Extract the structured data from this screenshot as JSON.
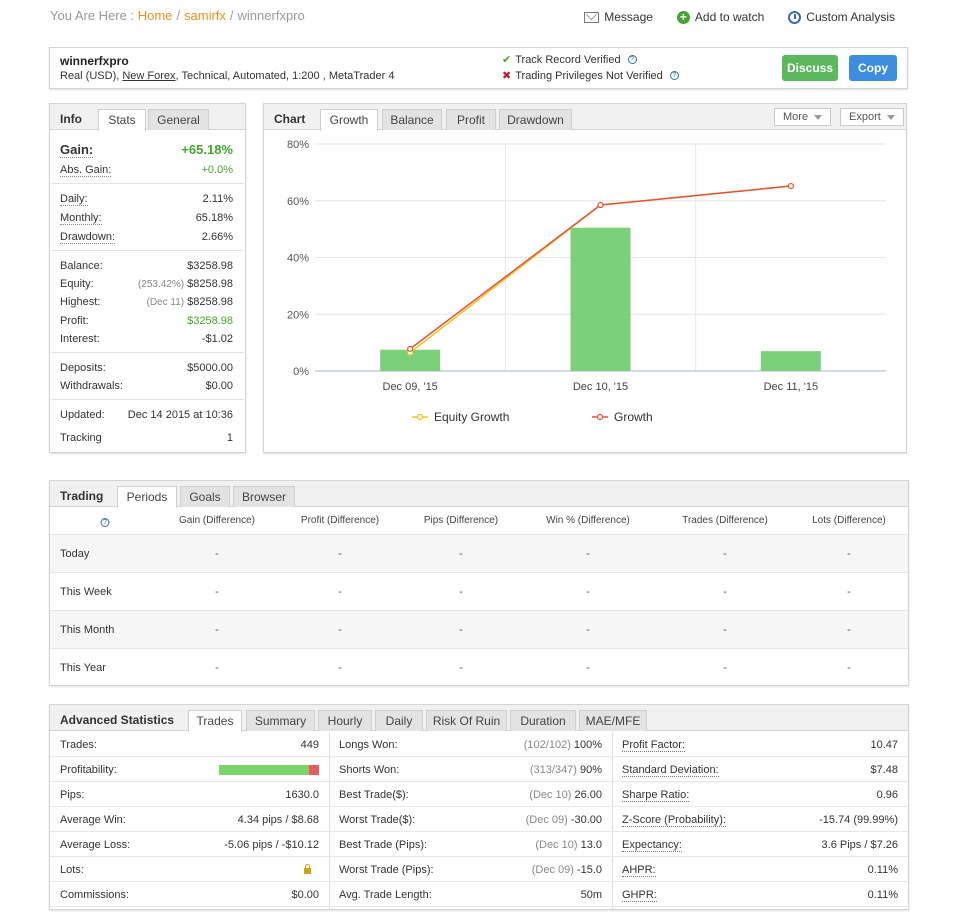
{
  "breadcrumb": {
    "prefix": "You Are Here :",
    "home": "Home",
    "user": "samirfx",
    "current": "winnerfxpro",
    "sep": "/"
  },
  "top_actions": {
    "message": "Message",
    "watch": "Add to watch",
    "analysis": "Custom Analysis"
  },
  "account": {
    "name": "winnerfxpro",
    "desc_prefix": "Real (USD), ",
    "broker": "New Forex",
    "desc_suffix": ", Technical, Automated, 1:200 , MetaTrader 4",
    "verified": "Track Record Verified",
    "not_verified": "Trading Privileges Not Verified",
    "ok_mark": "✔",
    "bad_mark": "✖",
    "qmark": "?",
    "discuss": "Discuss",
    "copy": "Copy"
  },
  "info": {
    "title": "Info",
    "tabs": [
      "Stats",
      "General"
    ],
    "gain_label": "Gain:",
    "gain": "+65.18%",
    "abs_gain_label": "Abs. Gain:",
    "abs_gain": "+0.0%",
    "daily_label": "Daily:",
    "daily": "2.11%",
    "monthly_label": "Monthly:",
    "monthly": "65.18%",
    "drawdown_label": "Drawdown:",
    "drawdown": "2.66%",
    "balance_label": "Balance:",
    "balance": "$3258.98",
    "equity_label": "Equity:",
    "equity_sub": "(253.42%)",
    "equity": "$8258.98",
    "highest_label": "Highest:",
    "highest_sub": "(Dec 11)",
    "highest": "$8258.98",
    "profit_label": "Profit:",
    "profit": "$3258.98",
    "interest_label": "Interest:",
    "interest": "-$1.02",
    "deposits_label": "Deposits:",
    "deposits": "$5000.00",
    "withdrawals_label": "Withdrawals:",
    "withdrawals": "$0.00",
    "updated_label": "Updated:",
    "updated": "Dec 14 2015 at 10:36",
    "tracking_label": "Tracking",
    "tracking": "1"
  },
  "chart_panel": {
    "title": "Chart",
    "tabs": [
      "Growth",
      "Balance",
      "Profit",
      "Drawdown"
    ],
    "more": "More",
    "export": "Export"
  },
  "chart_data": {
    "type": "bar",
    "categories": [
      "Dec 09, '15",
      "Dec 10, '15",
      "Dec 11, '15"
    ],
    "bars": [
      7.5,
      50.5,
      7.0
    ],
    "series": [
      {
        "name": "Equity Growth",
        "values": [
          6.5,
          58.5,
          65.18
        ],
        "color": "#f5c21b"
      },
      {
        "name": "Growth",
        "values": [
          7.8,
          58.5,
          65.18
        ],
        "color": "#e0553a"
      }
    ],
    "bar_color": "#7dd07a",
    "ylim": [
      0,
      80
    ],
    "yticks": [
      "0%",
      "20%",
      "40%",
      "60%",
      "80%"
    ],
    "legend": "bottom"
  },
  "trading": {
    "title": "Trading",
    "tabs": [
      "Periods",
      "Goals",
      "Browser"
    ],
    "help": "?",
    "columns": [
      "Gain (Difference)",
      "Profit (Difference)",
      "Pips (Difference)",
      "Win % (Difference)",
      "Trades (Difference)",
      "Lots (Difference)"
    ],
    "rows": [
      {
        "label": "Today",
        "cells": [
          "-",
          "-",
          "-",
          "-",
          "-",
          "-"
        ]
      },
      {
        "label": "This Week",
        "cells": [
          "-",
          "-",
          "-",
          "-",
          "-",
          "-"
        ]
      },
      {
        "label": "This Month",
        "cells": [
          "-",
          "-",
          "-",
          "-",
          "-",
          "-"
        ]
      },
      {
        "label": "This Year",
        "cells": [
          "-",
          "-",
          "-",
          "-",
          "-",
          "-"
        ]
      }
    ]
  },
  "advanced": {
    "title": "Advanced Statistics",
    "tabs": [
      "Trades",
      "Summary",
      "Hourly",
      "Daily",
      "Risk Of Ruin",
      "Duration",
      "MAE/MFE"
    ],
    "col1": [
      {
        "label": "Trades:",
        "value": "449"
      },
      {
        "label": "Profitability:",
        "value": ""
      },
      {
        "label": "Pips:",
        "value": "1630.0"
      },
      {
        "label": "Average Win:",
        "value": "4.34 pips / $8.68"
      },
      {
        "label": "Average Loss:",
        "value": "-5.06 pips / -$10.12"
      },
      {
        "label": "Lots:",
        "value": ""
      },
      {
        "label": "Commissions:",
        "value": "$0.00"
      }
    ],
    "profitability_win_pct": 90.2,
    "col2": [
      {
        "label": "Longs Won:",
        "sub": "(102/102)",
        "value": "100%"
      },
      {
        "label": "Shorts Won:",
        "sub": "(313/347)",
        "value": "90%"
      },
      {
        "label": "Best Trade($):",
        "sub": "(Dec 10)",
        "value": "26.00"
      },
      {
        "label": "Worst Trade($):",
        "sub": "(Dec 09)",
        "value": "-30.00"
      },
      {
        "label": "Best Trade (Pips):",
        "sub": "(Dec 10)",
        "value": "13.0"
      },
      {
        "label": "Worst Trade (Pips):",
        "sub": "(Dec 09)",
        "value": "-15.0"
      },
      {
        "label": "Avg. Trade Length:",
        "sub": "",
        "value": "50m"
      }
    ],
    "col3": [
      {
        "label": "Profit Factor:",
        "value": "10.47"
      },
      {
        "label": "Standard Deviation:",
        "value": "$7.48"
      },
      {
        "label": "Sharpe Ratio:",
        "value": "0.96"
      },
      {
        "label": "Z-Score (Probability):",
        "value": "-15.74 (99.99%)"
      },
      {
        "label": "Expectancy:",
        "value": "3.6 Pips / $7.26"
      },
      {
        "label": "AHPR:",
        "value": "0.11%"
      },
      {
        "label": "GHPR:",
        "value": "0.11%"
      }
    ]
  }
}
